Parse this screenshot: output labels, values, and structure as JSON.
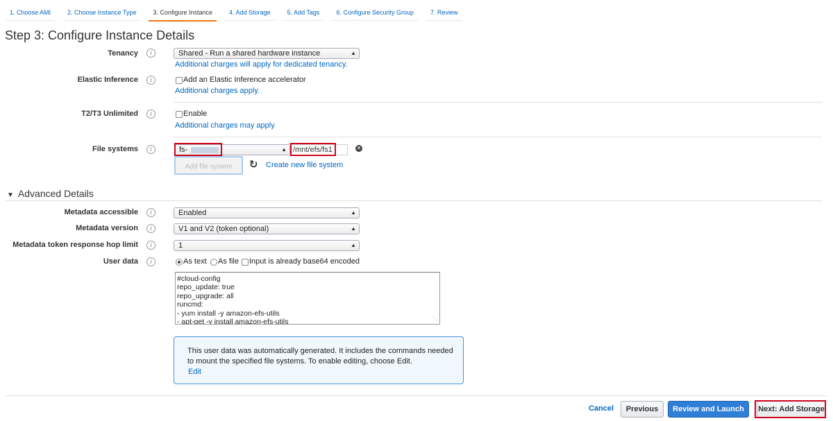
{
  "tabs": [
    {
      "label": "1. Choose AMI",
      "active": false
    },
    {
      "label": "2. Choose Instance Type",
      "active": false
    },
    {
      "label": "3. Configure Instance",
      "active": true
    },
    {
      "label": "4. Add Storage",
      "active": false
    },
    {
      "label": "5. Add Tags",
      "active": false
    },
    {
      "label": "6. Configure Security Group",
      "active": false
    },
    {
      "label": "7. Review",
      "active": false
    }
  ],
  "page_title": "Step 3: Configure Instance Details",
  "tenancy": {
    "label": "Tenancy",
    "value": "Shared - Run a shared hardware instance",
    "help": "Additional charges will apply for dedicated tenancy."
  },
  "elastic_inference": {
    "label": "Elastic Inference",
    "checkbox_label": "Add an Elastic Inference accelerator",
    "checked": false,
    "help": "Additional charges apply."
  },
  "t2t3": {
    "label": "T2/T3 Unlimited",
    "checkbox_label": "Enable",
    "checked": false,
    "help": "Additional charges may apply"
  },
  "file_systems": {
    "label": "File systems",
    "fs_value": "fs-",
    "mount_point": "/mnt/efs/fs1",
    "add_button": "Add file system",
    "create_link": "Create new file system"
  },
  "advanced": {
    "title": "Advanced Details",
    "metadata_accessible": {
      "label": "Metadata accessible",
      "value": "Enabled"
    },
    "metadata_version": {
      "label": "Metadata version",
      "value": "V1 and V2 (token optional)"
    },
    "hop_limit": {
      "label": "Metadata token response hop limit",
      "value": "1"
    },
    "user_data": {
      "label": "User data",
      "options": [
        "As text",
        "As file"
      ],
      "selected": "As text",
      "base64_label": "Input is already base64 encoded",
      "lines": [
        "#cloud-config",
        "repo_update: true",
        "repo_upgrade: all",
        "runcmd:",
        "- yum install -y amazon-efs-utils",
        "- apt-get -y install amazon-efs-utils"
      ]
    },
    "info_box": {
      "text": "This user data was automatically generated. It includes the commands needed to mount the specified file systems. To enable editing, choose Edit.",
      "edit_label": "Edit"
    }
  },
  "footer": {
    "cancel": "Cancel",
    "previous": "Previous",
    "review_launch": "Review and Launch",
    "next": "Next: Add Storage"
  },
  "colors": {
    "accent": "#ec7211",
    "link": "#0066c0",
    "primary": "#2f7ed8",
    "highlight": "#d0021b"
  }
}
